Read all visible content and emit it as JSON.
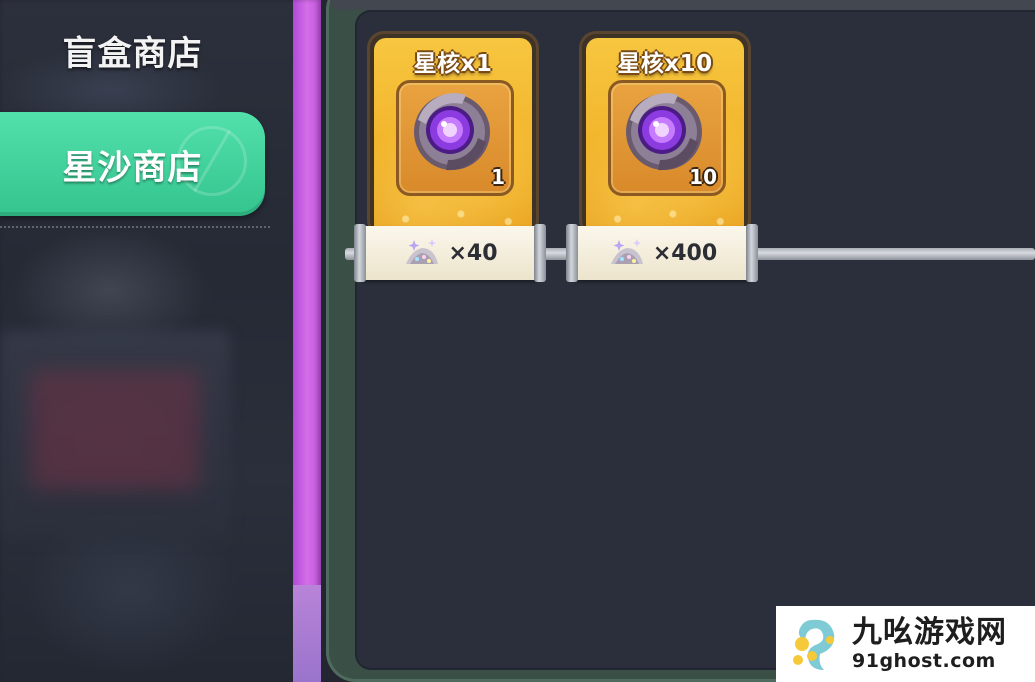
{
  "sidebar": {
    "tabs": [
      {
        "label": "盲盒商店",
        "active": false
      },
      {
        "label": "星沙商店",
        "active": true
      }
    ]
  },
  "shop": {
    "items": [
      {
        "title": "星核x1",
        "quantity": "1",
        "price": "×40",
        "icon": "star-core-icon",
        "currency_icon": "star-sand-icon"
      },
      {
        "title": "星核x10",
        "quantity": "10",
        "price": "×400",
        "icon": "star-core-icon",
        "currency_icon": "star-sand-icon"
      }
    ]
  },
  "watermark": {
    "name": "九吆游戏网",
    "url": "91ghost.com"
  },
  "colors": {
    "active_tab": "#42d49c",
    "card_gold": "#f2b52b",
    "side_strip": "#c055dc",
    "panel_bg": "#2a2f3b"
  }
}
